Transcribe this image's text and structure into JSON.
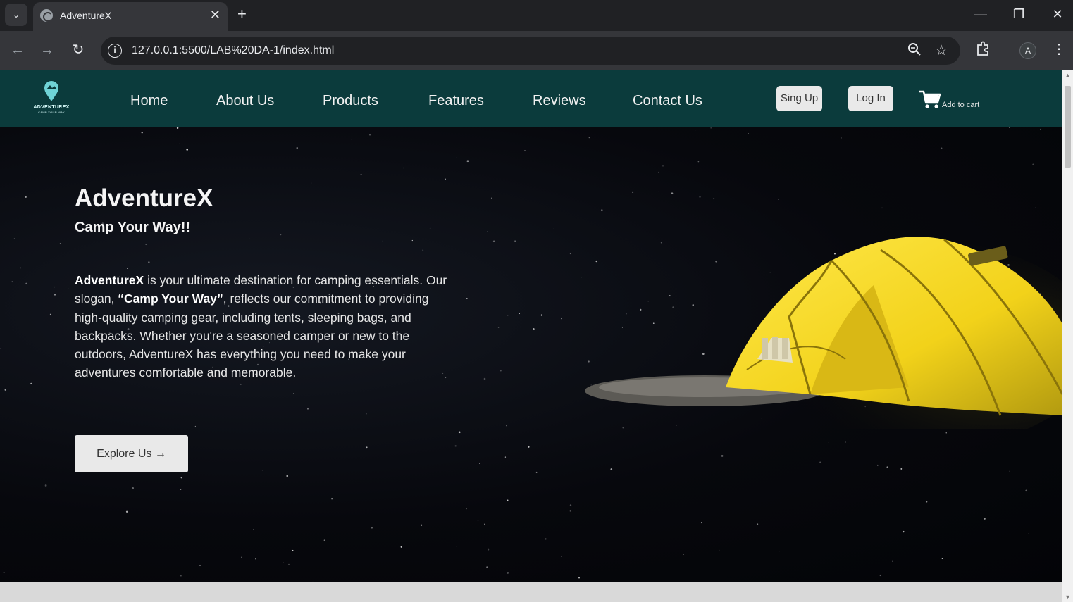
{
  "browser": {
    "tab_title": "AdventureX",
    "url": "127.0.0.1:5500/LAB%20DA-1/index.html",
    "profile_initial": "A",
    "accent_color": "#202124"
  },
  "site": {
    "logo_text": "ADVENTUREX",
    "logo_tagline": "CAMP YOUR WAY",
    "nav_links": [
      "Home",
      "About Us",
      "Products",
      "Features",
      "Reviews",
      "Contact Us"
    ],
    "signup_label": "Sing Up",
    "login_label": "Log In",
    "cart_label": "Add to cart",
    "nav_color": "#0b3b3c"
  },
  "hero": {
    "title": "AdventureX",
    "subtitle": "Camp Your Way!!",
    "desc_brand": "AdventureX",
    "desc_part1": " is your ultimate destination for camping essentials. Our slogan, ",
    "desc_slogan": "“Camp Your Way”",
    "desc_part2": ", reflects our commitment to providing high-quality camping gear, including tents, sleeping bags, and backpacks. Whether you're a seasoned camper or new to the outdoors, AdventureX has everything you need to make your adventures comfortable and memorable.",
    "explore_label": "Explore Us →",
    "tent_color": "#f2d21a"
  }
}
